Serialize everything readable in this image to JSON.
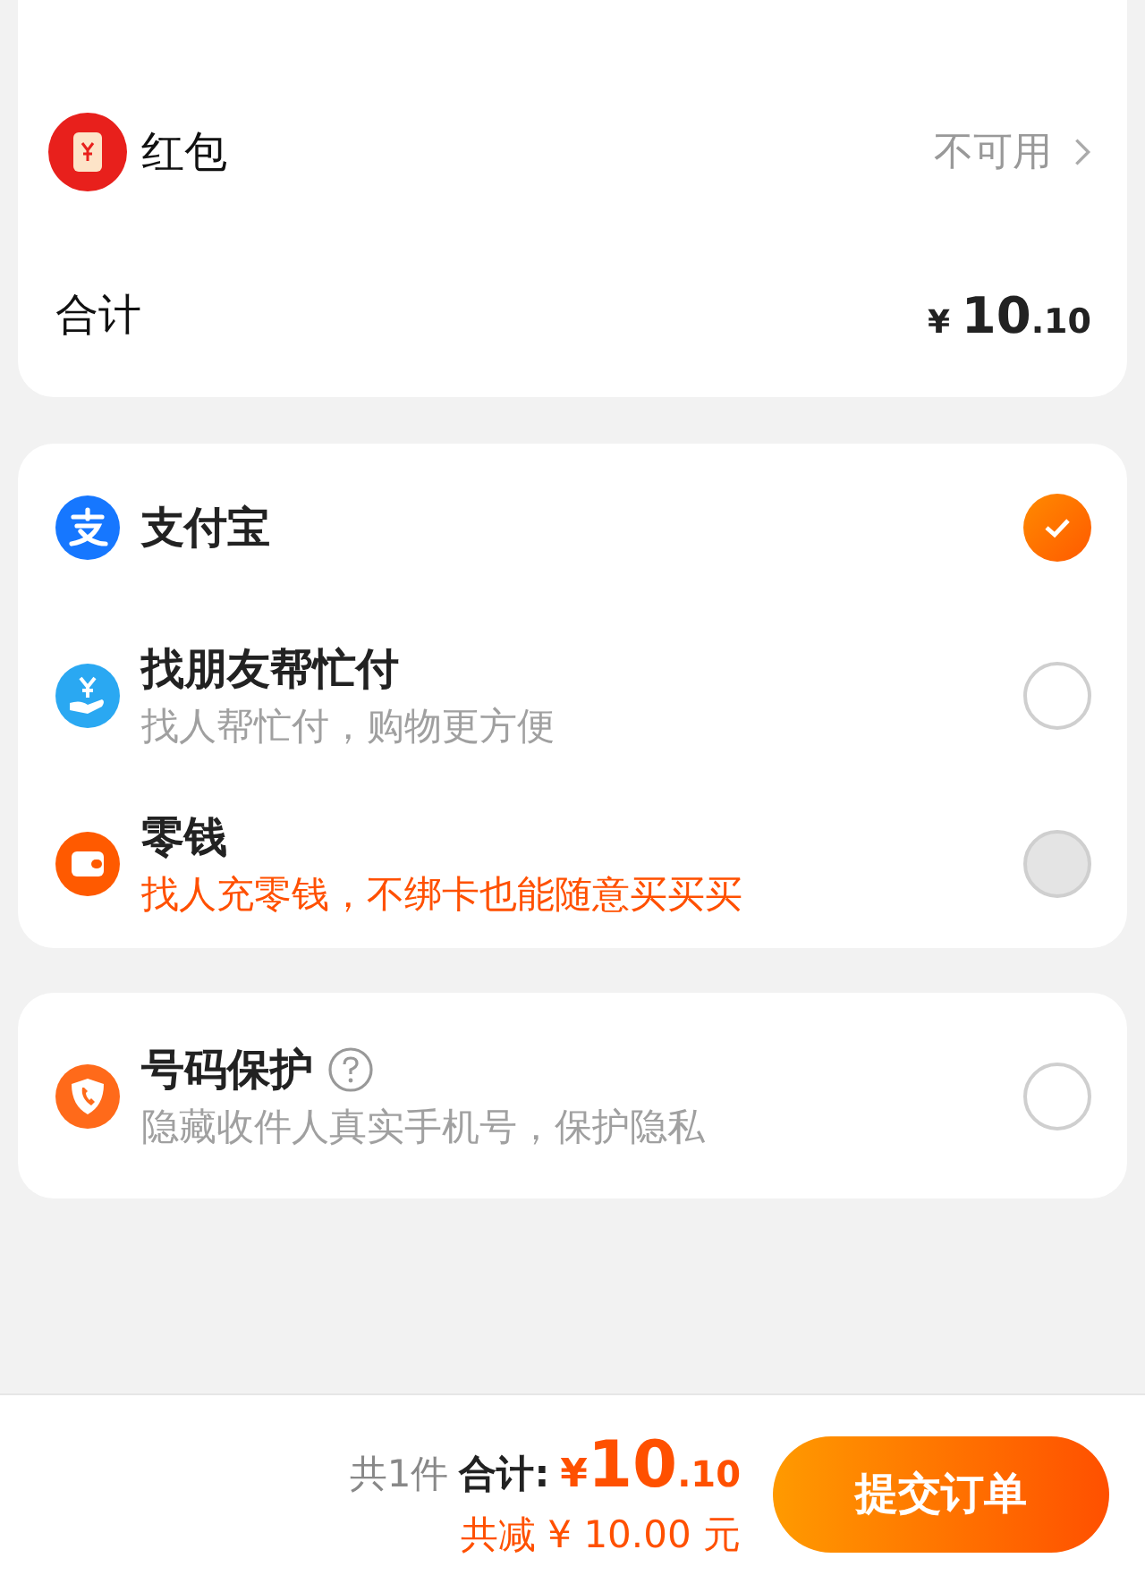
{
  "red_packet": {
    "label": "红包",
    "status": "不可用"
  },
  "total": {
    "label": "合计",
    "currency": "¥",
    "integer": "10",
    "decimal": ".10"
  },
  "payment_methods": [
    {
      "kind": "alipay",
      "title": "支付宝",
      "selected": true,
      "disabled": false
    },
    {
      "kind": "friend",
      "title": "找朋友帮忙付",
      "subtitle": "找人帮忙付，购物更方便",
      "highlighted": false,
      "selected": false,
      "disabled": false
    },
    {
      "kind": "wallet",
      "title": "零钱",
      "subtitle": "找人充零钱，不绑卡也能随意买买买",
      "highlighted": true,
      "selected": false,
      "disabled": true
    }
  ],
  "number_protection": {
    "title": "号码保护",
    "subtitle": "隐藏收件人真实手机号，保护隐私",
    "checked": false
  },
  "footer": {
    "count": "共1件",
    "total_label": "合计:",
    "currency": "¥",
    "integer": "10",
    "decimal": ".10",
    "reduction": "共减 ¥ 10.00 元",
    "submit": "提交订单"
  }
}
